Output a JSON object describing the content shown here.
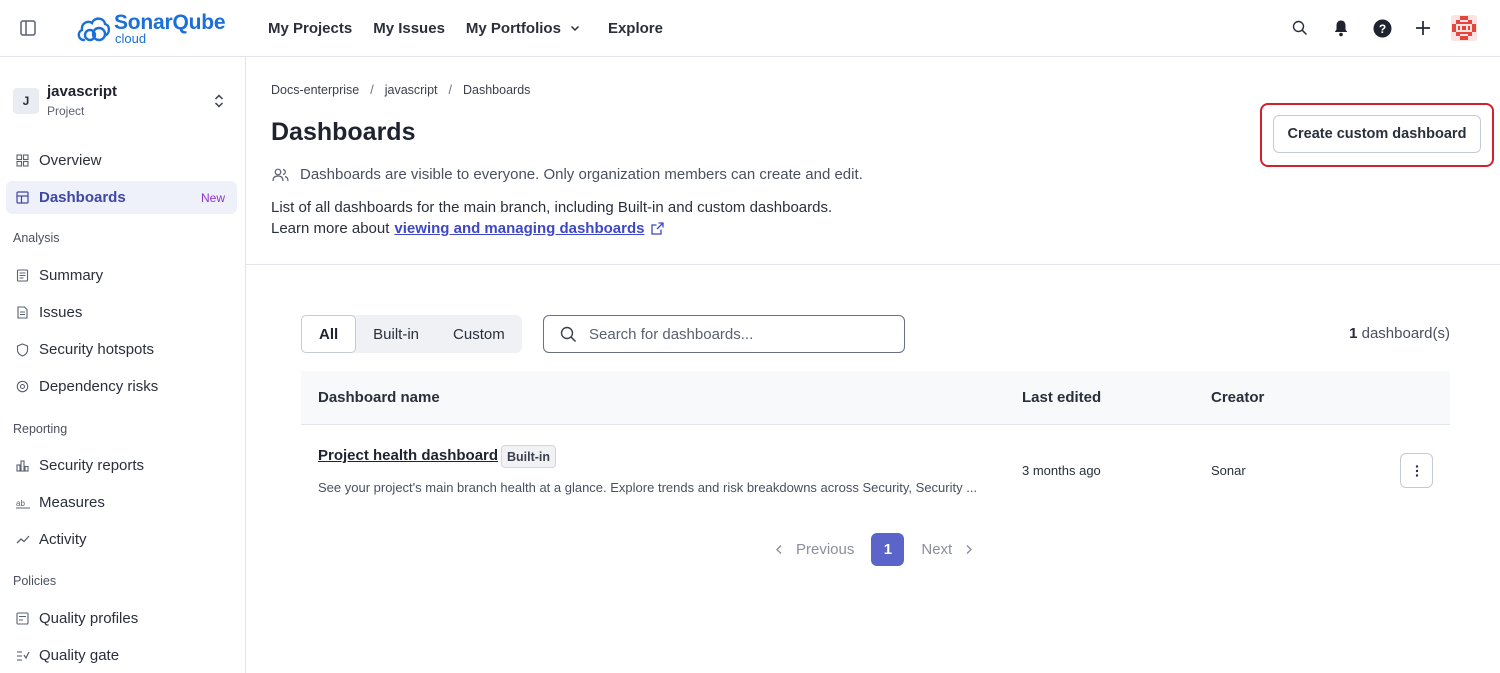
{
  "app": {
    "brand": "SonarQube",
    "brand_sub": "cloud"
  },
  "topnav": {
    "items": [
      "My Projects",
      "My Issues",
      "My Portfolios",
      "Explore"
    ]
  },
  "top_actions": [
    "search-icon",
    "bell-icon",
    "help-icon",
    "plus-icon",
    "user-avatar"
  ],
  "sidebar": {
    "project_initial": "J",
    "project_name": "javascript",
    "project_type": "Project",
    "overview": "Overview",
    "dashboards": "Dashboards",
    "dashboards_badge": "New",
    "sections": {
      "analysis": "Analysis",
      "reporting": "Reporting",
      "policies": "Policies"
    },
    "analysis_items": [
      "Summary",
      "Issues",
      "Security hotspots",
      "Dependency risks"
    ],
    "reporting_items": [
      "Security reports",
      "Measures",
      "Activity"
    ],
    "policies_items": [
      "Quality profiles",
      "Quality gate"
    ]
  },
  "breadcrumb": [
    "Docs-enterprise",
    "javascript",
    "Dashboards"
  ],
  "page": {
    "title": "Dashboards",
    "visibility_note": "Dashboards are visible to everyone. Only organization members can create and edit.",
    "description": "List of all dashboards for the main branch, including Built-in and custom dashboards.",
    "learn_more_prefix": "Learn more about",
    "learn_more_link": "viewing and managing dashboards",
    "create_button": "Create custom dashboard"
  },
  "filters": {
    "options": [
      "All",
      "Built-in",
      "Custom"
    ],
    "selected": "All",
    "search_placeholder": "Search for dashboards...",
    "count_value": "1",
    "count_label": "dashboard(s)"
  },
  "table": {
    "headers": {
      "name": "Dashboard name",
      "edited": "Last edited",
      "creator": "Creator"
    },
    "rows": [
      {
        "name": "Project health dashboard",
        "badge": "Built-in",
        "description": "See your project's main branch health at a glance. Explore trends and risk breakdowns across Security, Security ...",
        "last_edited": "3 months ago",
        "creator": "Sonar"
      }
    ]
  },
  "pagination": {
    "previous": "Previous",
    "current": "1",
    "next": "Next"
  },
  "colors": {
    "accent": "#5b64c8",
    "brand_blue": "#1b6fd8",
    "highlight_red": "#d0212d",
    "badge_new": "#8d36c9"
  }
}
